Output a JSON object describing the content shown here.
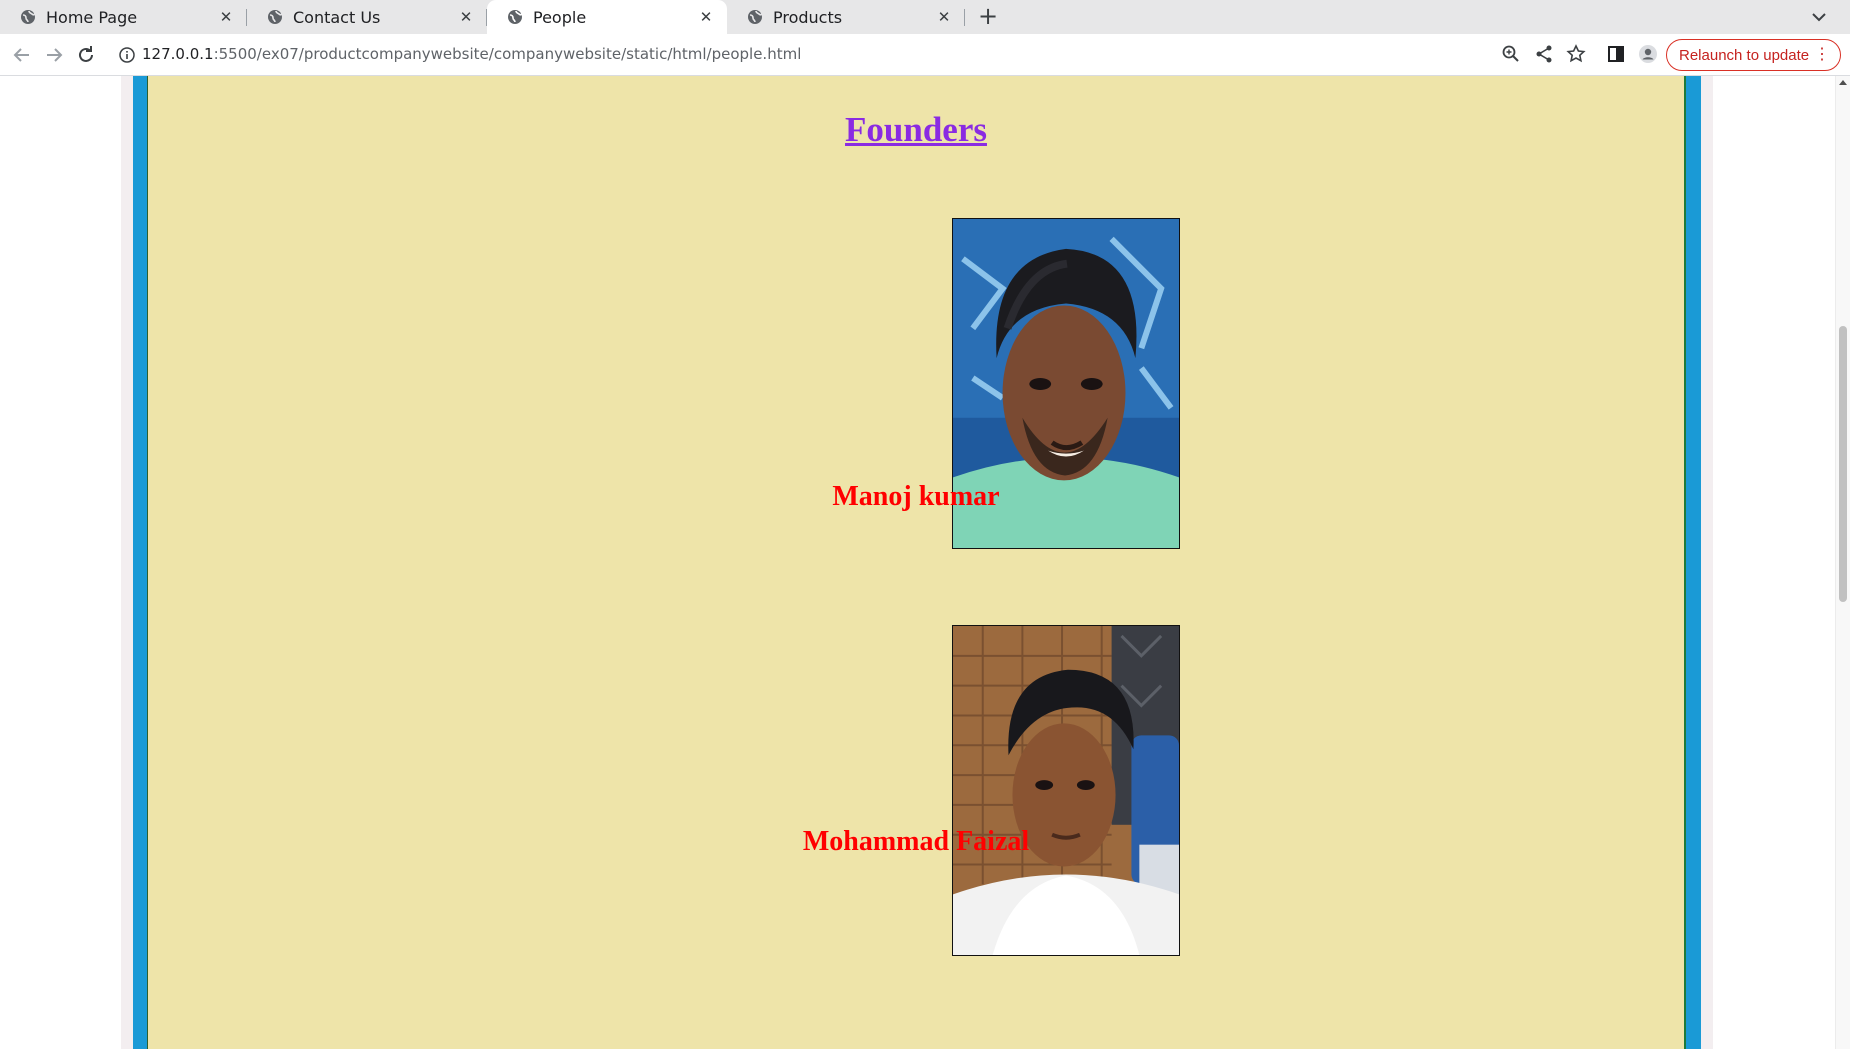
{
  "browser": {
    "tabs": [
      {
        "label": "Home Page",
        "active": false
      },
      {
        "label": "Contact Us",
        "active": false
      },
      {
        "label": "People",
        "active": true
      },
      {
        "label": "Products",
        "active": false
      }
    ],
    "url_host": "127.0.0.1",
    "url_rest": ":5500/ex07/productcompanywebsite/companywebsite/static/html/people.html",
    "relaunch_label": "Relaunch to update",
    "accent_color": "#d93025"
  },
  "page": {
    "heading": "Founders",
    "heading_color": "#8a2be2",
    "name_color": "#ff0000",
    "background_color": "#eee4a9",
    "frame_color": "#1a9ad6",
    "founders": [
      {
        "name": "Manoj kumar"
      },
      {
        "name": "Mohammad Faizal"
      }
    ]
  }
}
